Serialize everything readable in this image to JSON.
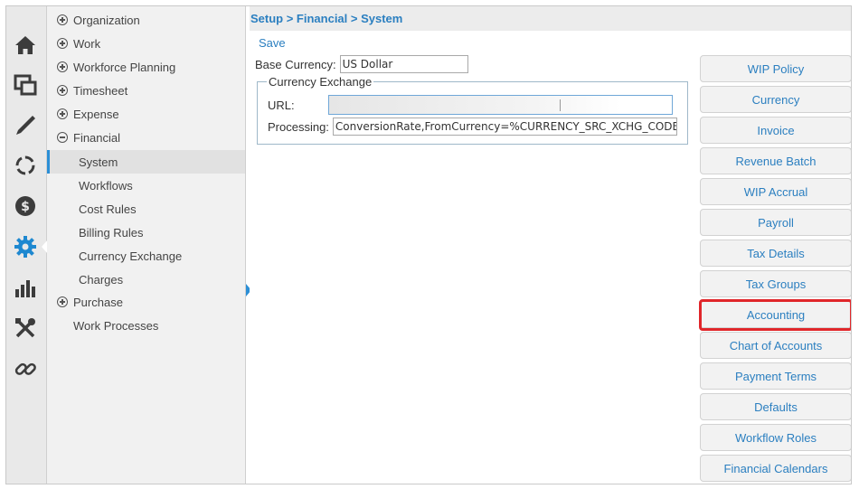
{
  "breadcrumb": "Setup > Financial > System",
  "toolbar": {
    "save_label": "Save"
  },
  "form": {
    "base_currency_label": "Base Currency:",
    "base_currency_value": "US Dollar",
    "fieldset_legend": "Currency Exchange",
    "url_label": "URL:",
    "processing_label": "Processing:",
    "processing_value": "ConversionRate,FromCurrency=%CURRENCY_SRC_XCHG_CODE%,To"
  },
  "rail_icons": [
    "home-icon",
    "windows-icon",
    "pencil-icon",
    "refresh-circle-icon",
    "dollar-icon",
    "gear-icon",
    "bar-chart-icon",
    "tools-icon",
    "link-icon"
  ],
  "tree": {
    "items": [
      {
        "label": "Organization",
        "toggle": "plus"
      },
      {
        "label": "Work",
        "toggle": "plus"
      },
      {
        "label": "Workforce Planning",
        "toggle": "plus"
      },
      {
        "label": "Timesheet",
        "toggle": "plus"
      },
      {
        "label": "Expense",
        "toggle": "plus"
      },
      {
        "label": "Financial",
        "toggle": "minus"
      },
      {
        "label": "System",
        "selected": true
      },
      {
        "label": "Workflows"
      },
      {
        "label": "Cost Rules"
      },
      {
        "label": "Billing Rules"
      },
      {
        "label": "Currency Exchange"
      },
      {
        "label": "Charges"
      },
      {
        "label": "Purchase",
        "toggle": "plus"
      },
      {
        "label": "Work Processes"
      }
    ]
  },
  "side_buttons": [
    "WIP Policy",
    "Currency",
    "Invoice",
    "Revenue Batch",
    "WIP Accrual",
    "Payroll",
    "Tax Details",
    "Tax Groups",
    "Accounting",
    "Chart of Accounts",
    "Payment Terms",
    "Defaults",
    "Workflow Roles",
    "Financial Calendars"
  ],
  "highlighted_button": "Accounting",
  "colors": {
    "accent": "#2b7fc0",
    "highlight": "#e0262a",
    "icon": "#3c3c3c",
    "active_icon": "#1e88d0"
  }
}
